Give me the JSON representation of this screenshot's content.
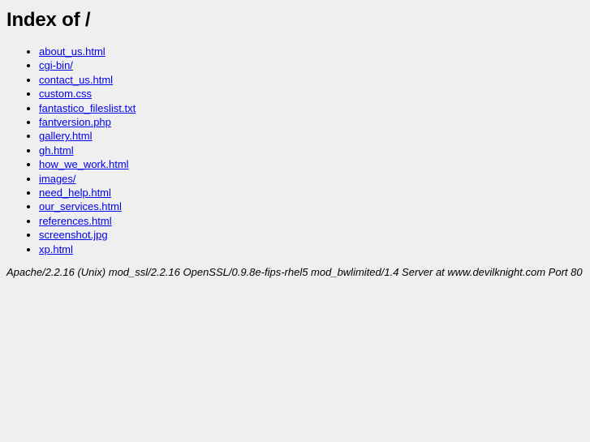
{
  "page": {
    "heading_prefix": "Index of",
    "heading_path": "/",
    "background_color": "#efefef",
    "link_color": "#0000ee",
    "text_color": "#000000"
  },
  "listing": {
    "items": [
      {
        "label": "about_us.html"
      },
      {
        "label": "cgi-bin/"
      },
      {
        "label": "contact_us.html"
      },
      {
        "label": "custom.css"
      },
      {
        "label": "fantastico_fileslist.txt"
      },
      {
        "label": "fantversion.php"
      },
      {
        "label": "gallery.html"
      },
      {
        "label": "gh.html"
      },
      {
        "label": "how_we_work.html"
      },
      {
        "label": "images/"
      },
      {
        "label": "need_help.html"
      },
      {
        "label": "our_services.html"
      },
      {
        "label": "references.html"
      },
      {
        "label": "screenshot.jpg"
      },
      {
        "label": "xp.html"
      }
    ]
  },
  "footer": {
    "signature": "Apache/2.2.16 (Unix) mod_ssl/2.2.16 OpenSSL/0.9.8e-fips-rhel5 mod_bwlimited/1.4 Server at www.devilknight.com Port 80"
  }
}
